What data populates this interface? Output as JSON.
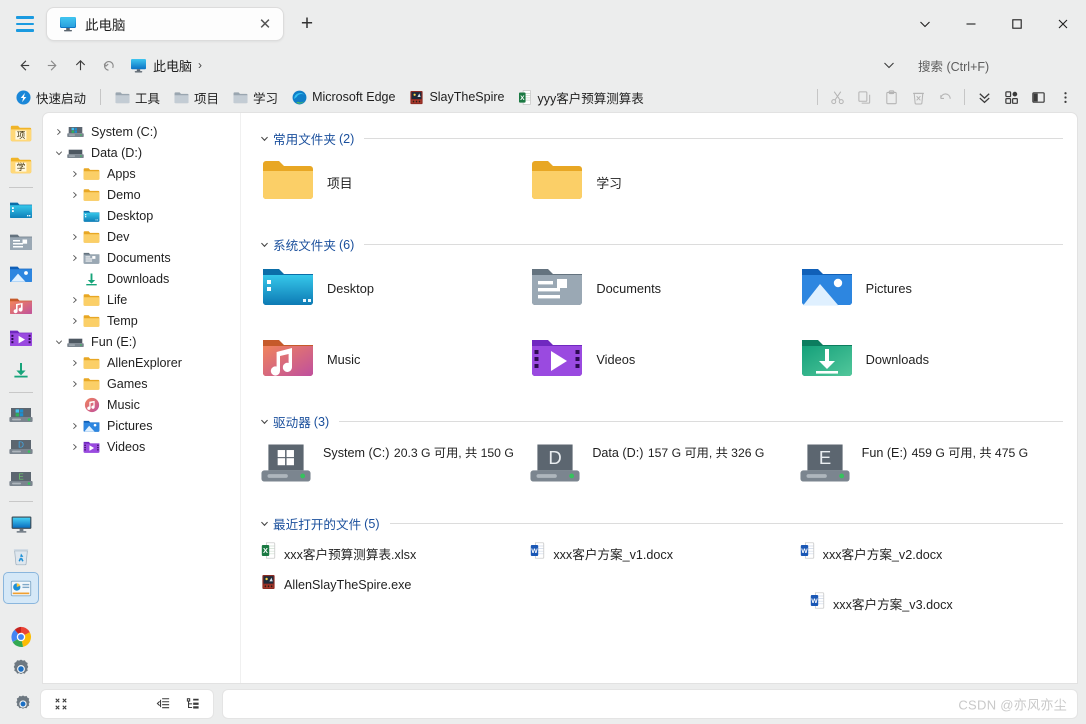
{
  "window": {
    "hamburger": "hamburger-menu",
    "tab": {
      "label": "此电脑",
      "icon": "this-pc-icon",
      "close": "✕",
      "new_tab": "+"
    },
    "controls": {
      "chevron": "⌄",
      "minimize": "—",
      "maximize": "☐",
      "close": "✕"
    }
  },
  "nav": {
    "back": "←",
    "forward": "→",
    "up": "↑",
    "refresh": "↶",
    "breadcrumb": {
      "icon": "this-pc-icon",
      "text": "此电脑",
      "separator": "›"
    },
    "chevron": "⌄"
  },
  "search": {
    "placeholder": "搜索 (Ctrl+F)",
    "value": ""
  },
  "bookmarks": {
    "quick": {
      "label": "快速启动",
      "icon": "quick-launch-icon"
    },
    "items": [
      {
        "label": "工具",
        "icon": "folder-gray-icon"
      },
      {
        "label": "项目",
        "icon": "folder-gray-icon"
      },
      {
        "label": "学习",
        "icon": "folder-gray-icon"
      },
      {
        "label": "Microsoft Edge",
        "icon": "edge-icon"
      },
      {
        "label": "SlayTheSpire",
        "icon": "slaythespire-icon"
      },
      {
        "label": "yyy客户预算测算表",
        "icon": "excel-icon"
      }
    ]
  },
  "toolbar": {
    "icons": [
      {
        "name": "cut-icon",
        "glyph": "✂"
      },
      {
        "name": "copy-icon",
        "glyph": "⧉"
      },
      {
        "name": "paste-icon",
        "glyph": "📋"
      },
      {
        "name": "delete-icon",
        "glyph": "🗑"
      },
      {
        "name": "undo-icon",
        "glyph": "↩"
      }
    ],
    "right_icons": [
      {
        "name": "chevron-double-down-icon",
        "glyph": "⌄⌄"
      },
      {
        "name": "layout-grid-icon",
        "glyph": "▦"
      },
      {
        "name": "panel-toggle-icon",
        "glyph": "▮"
      },
      {
        "name": "more-options-icon",
        "glyph": "⋮"
      }
    ]
  },
  "rail": {
    "items": [
      {
        "name": "rail-folder-xiang",
        "icon": "folder-yellow-char-icon",
        "char": "项"
      },
      {
        "name": "rail-folder-xue",
        "icon": "folder-yellow-char-icon",
        "char": "学"
      },
      {
        "name": "divider-1",
        "icon": "divider"
      },
      {
        "name": "rail-desktop",
        "icon": "desktop-folder-icon"
      },
      {
        "name": "rail-documents",
        "icon": "documents-folder-icon"
      },
      {
        "name": "rail-pictures",
        "icon": "pictures-folder-icon"
      },
      {
        "name": "rail-music",
        "icon": "music-folder-icon"
      },
      {
        "name": "rail-videos",
        "icon": "videos-folder-icon"
      },
      {
        "name": "rail-downloads",
        "icon": "downloads-folder-icon"
      },
      {
        "name": "divider-2",
        "icon": "divider"
      },
      {
        "name": "rail-drive-c",
        "icon": "drive-windows-icon"
      },
      {
        "name": "rail-drive-d",
        "icon": "drive-letter-icon",
        "letter": "D"
      },
      {
        "name": "rail-drive-e",
        "icon": "drive-letter-icon",
        "letter": "E"
      },
      {
        "name": "divider-3",
        "icon": "divider"
      },
      {
        "name": "rail-this-pc",
        "icon": "this-pc-icon"
      },
      {
        "name": "rail-recycle-bin",
        "icon": "recycle-bin-icon"
      },
      {
        "name": "rail-control-panel",
        "icon": "control-panel-icon",
        "selected": true
      },
      {
        "name": "rail-chrome",
        "icon": "chrome-icon"
      },
      {
        "name": "rail-settings",
        "icon": "settings-gear-icon"
      }
    ]
  },
  "tree": {
    "nodes": [
      {
        "label": "System (C:)",
        "icon": "drive-windows-icon",
        "depth": 0,
        "chevron": "›",
        "expanded": false
      },
      {
        "label": "Data (D:)",
        "icon": "drive-plain-icon",
        "depth": 0,
        "chevron": "⌄",
        "expanded": true
      },
      {
        "label": "Apps",
        "icon": "folder-yellow-icon",
        "depth": 1,
        "chevron": "›",
        "expanded": false
      },
      {
        "label": "Demo",
        "icon": "folder-yellow-icon",
        "depth": 1,
        "chevron": "›",
        "expanded": false
      },
      {
        "label": "Desktop",
        "icon": "desktop-folder-icon",
        "depth": 1,
        "chevron": "",
        "expanded": false
      },
      {
        "label": "Dev",
        "icon": "folder-yellow-icon",
        "depth": 1,
        "chevron": "›",
        "expanded": false
      },
      {
        "label": "Documents",
        "icon": "documents-folder-icon",
        "depth": 1,
        "chevron": "›",
        "expanded": false
      },
      {
        "label": "Downloads",
        "icon": "download-arrow-icon",
        "depth": 1,
        "chevron": "",
        "expanded": false
      },
      {
        "label": "Life",
        "icon": "folder-yellow-icon",
        "depth": 1,
        "chevron": "›",
        "expanded": false
      },
      {
        "label": "Temp",
        "icon": "folder-yellow-icon",
        "depth": 1,
        "chevron": "›",
        "expanded": false
      },
      {
        "label": "Fun (E:)",
        "icon": "drive-plain-icon",
        "depth": 0,
        "chevron": "⌄",
        "expanded": true
      },
      {
        "label": "AllenExplorer",
        "icon": "folder-yellow-icon",
        "depth": 1,
        "chevron": "›",
        "expanded": false
      },
      {
        "label": "Games",
        "icon": "folder-yellow-icon",
        "depth": 1,
        "chevron": "›",
        "expanded": false
      },
      {
        "label": "Music",
        "icon": "music-circle-icon",
        "depth": 1,
        "chevron": "",
        "expanded": false
      },
      {
        "label": "Pictures",
        "icon": "pictures-folder-icon",
        "depth": 1,
        "chevron": "›",
        "expanded": false
      },
      {
        "label": "Videos",
        "icon": "videos-folder-icon",
        "depth": 1,
        "chevron": "›",
        "expanded": false
      }
    ]
  },
  "sections": {
    "frequent": {
      "title": "常用文件夹",
      "count": "(2)",
      "chevron": "⌄",
      "items": [
        {
          "label": "项目",
          "icon": "folder-yellow-icon"
        },
        {
          "label": "学习",
          "icon": "folder-yellow-icon"
        }
      ]
    },
    "system": {
      "title": "系统文件夹",
      "count": "(6)",
      "chevron": "⌄",
      "items": [
        {
          "label": "Desktop",
          "icon": "desktop-folder-icon"
        },
        {
          "label": "Documents",
          "icon": "documents-folder-icon"
        },
        {
          "label": "Pictures",
          "icon": "pictures-folder-icon"
        },
        {
          "label": "Music",
          "icon": "music-folder-icon"
        },
        {
          "label": "Videos",
          "icon": "videos-folder-icon"
        },
        {
          "label": "Downloads",
          "icon": "downloads-folder-icon"
        }
      ]
    },
    "drives": {
      "title": "驱动器",
      "count": "(3)",
      "chevron": "⌄",
      "items": [
        {
          "name": "System (C:)",
          "capacity": "20.3 G 可用, 共 150 G",
          "used_percent": 86,
          "icon": "drive-windows-icon",
          "letter": ""
        },
        {
          "name": "Data (D:)",
          "capacity": "157 G 可用, 共 326 G",
          "used_percent": 52,
          "icon": "drive-letter-icon",
          "letter": "D"
        },
        {
          "name": "Fun (E:)",
          "capacity": "459 G 可用, 共 475 G",
          "used_percent": 4,
          "icon": "drive-letter-icon",
          "letter": "E"
        }
      ]
    },
    "recent": {
      "title": "最近打开的文件",
      "count": "(5)",
      "chevron": "⌄",
      "items": [
        {
          "label": "xxx客户预算测算表.xlsx",
          "icon": "excel-icon"
        },
        {
          "label": "xxx客户方案_v1.docx",
          "icon": "word-icon"
        },
        {
          "label": "xxx客户方案_v2.docx",
          "icon": "word-icon"
        },
        {
          "label": "xxx客户方案_v3.docx",
          "icon": "word-icon"
        },
        {
          "label": "AllenSlayTheSpire.exe",
          "icon": "slaythespire-icon"
        }
      ]
    }
  },
  "statusbar": {
    "gear": "settings-gear-icon",
    "collapse": "collapse-icon",
    "indent": "indent-icon",
    "tree_view": "tree-view-icon",
    "watermark": "CSDN @亦风亦尘"
  },
  "colors": {
    "accent": "#2aa3e0",
    "section_title": "#1a4f9c",
    "window_bg": "#eceded",
    "panel_bg": "#ffffff"
  }
}
